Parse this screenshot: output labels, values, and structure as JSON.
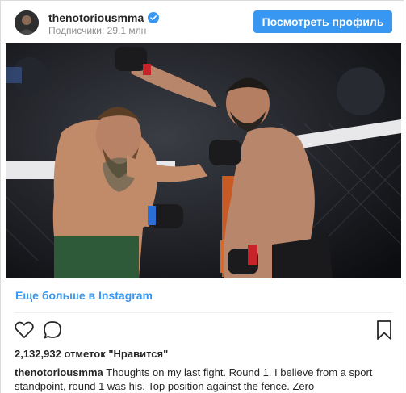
{
  "header": {
    "username": "thenotoriousmma",
    "followers": "Подписчики: 29.1 млн",
    "view_profile_label": "Посмотреть профиль"
  },
  "post": {
    "more_link": "Еще больше в Instagram",
    "likes": "2,132,932 отметок \"Нравится\"",
    "caption_user": "thenotoriousmma",
    "caption_text": "Thoughts on my last fight. Round 1. I believe from a sport standpoint, round 1 was his. Top position against the fence. Zero"
  },
  "icons": {
    "verified": "verified-badge-icon",
    "like": "heart-icon",
    "comment": "comment-icon",
    "save": "bookmark-icon"
  },
  "colors": {
    "accent": "#3897f0",
    "text": "#262626",
    "muted": "#8e8e8e",
    "border": "#dbdbdb"
  }
}
